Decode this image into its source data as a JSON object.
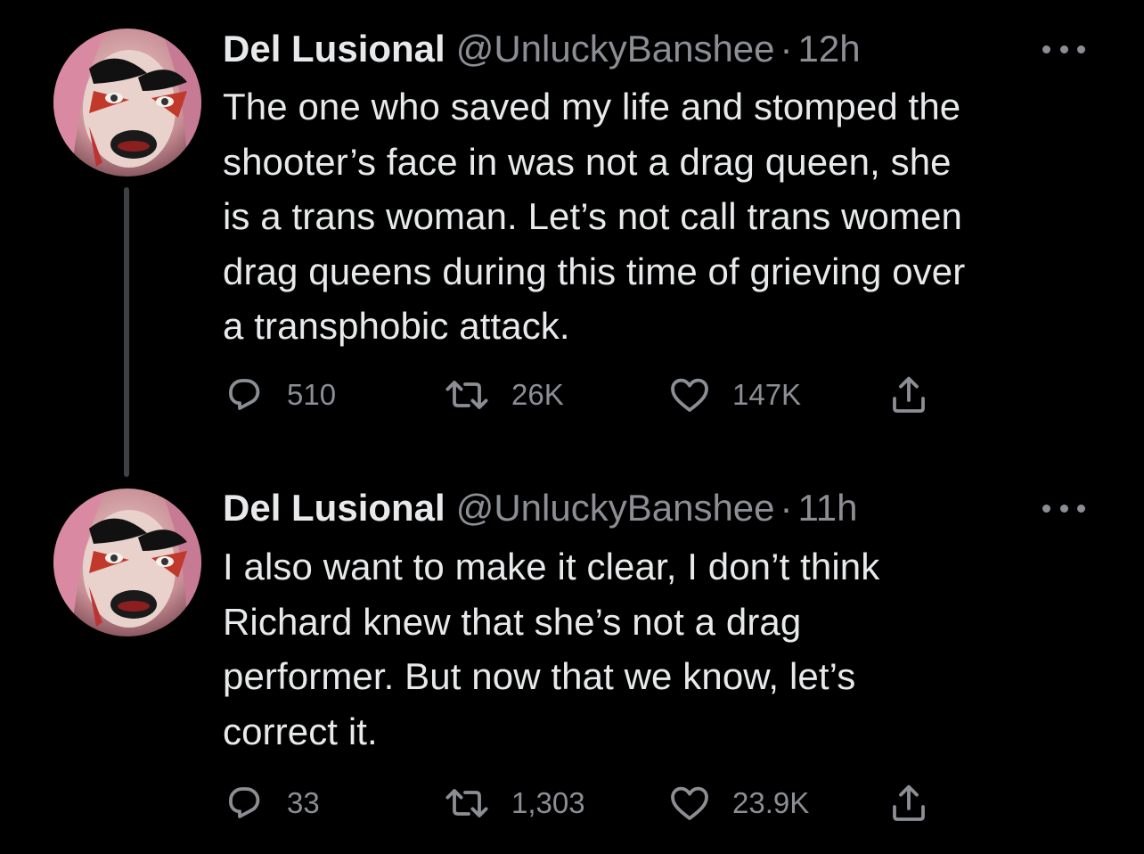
{
  "tweets": [
    {
      "display_name": "Del Lusional",
      "handle": "@UnluckyBanshee",
      "separator": "·",
      "time": "12h",
      "avatar_icon": "profile-avatar",
      "text_lines": [
        "The one who saved my life and stomped the",
        "shooter’s face in was not a drag queen, she",
        "is a trans woman. Let’s not call trans women",
        "drag queens during this time of grieving over",
        "a transphobic attack."
      ],
      "replies": "510",
      "retweets": "26K",
      "likes": "147K"
    },
    {
      "display_name": "Del Lusional",
      "handle": "@UnluckyBanshee",
      "separator": "·",
      "time": "11h",
      "avatar_icon": "profile-avatar",
      "text_lines": [
        "I also want to make it clear, I don’t think",
        "Richard knew that she’s not a drag",
        "performer. But now that we know, let’s",
        "correct it."
      ],
      "replies": "33",
      "retweets": "1,303",
      "likes": "23.9K"
    }
  ],
  "colors": {
    "background": "#000000",
    "primary_text": "#e7e9ea",
    "secondary_text": "#8b8f94",
    "thread_line": "#3e4144"
  },
  "icons": {
    "reply": "reply-icon",
    "retweet": "retweet-icon",
    "like": "heart-icon",
    "share": "share-icon",
    "more": "more-options-icon"
  }
}
